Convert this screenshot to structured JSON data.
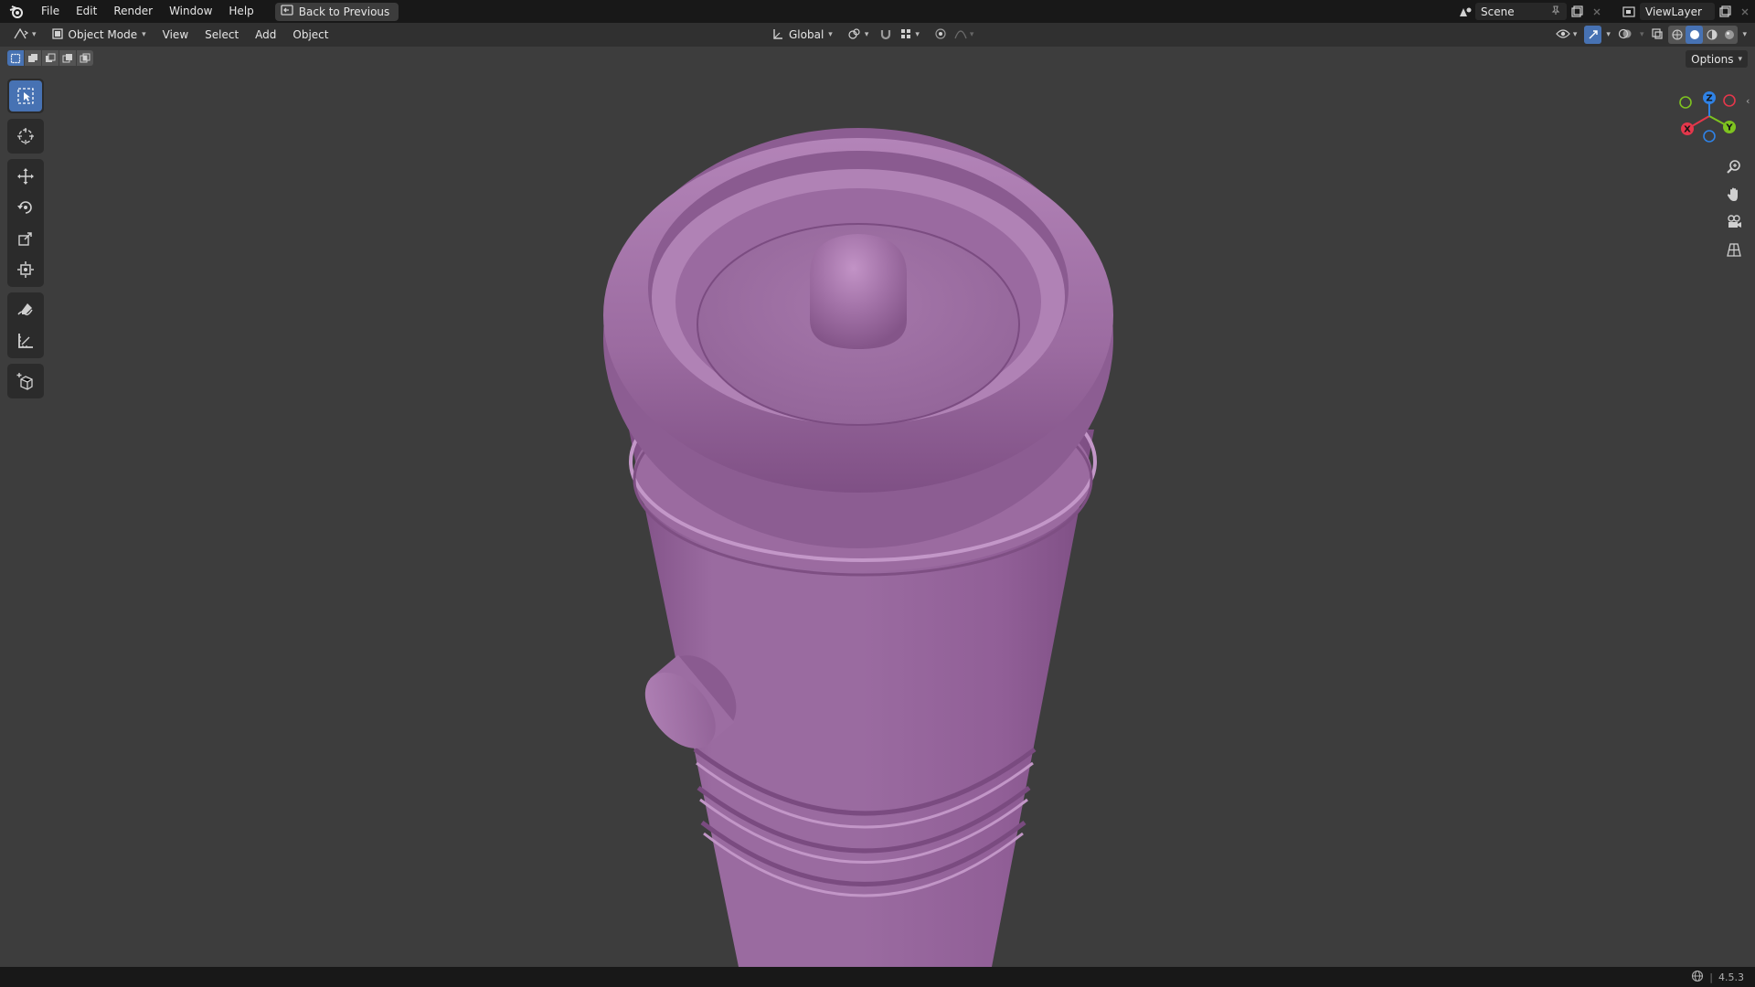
{
  "menu": {
    "items": [
      "File",
      "Edit",
      "Render",
      "Window",
      "Help"
    ],
    "back_button": "Back to Previous"
  },
  "workspace": {
    "scene_name": "Scene",
    "view_layer_name": "ViewLayer"
  },
  "viewport_header": {
    "mode": "Object Mode",
    "menus": [
      "View",
      "Select",
      "Add",
      "Object"
    ],
    "transform_orientation": "Global",
    "options_label": "Options"
  },
  "toolbar": {
    "tools": [
      "select-box",
      "cursor",
      "move",
      "rotate",
      "scale",
      "transform",
      "annotate",
      "measure",
      "add-cube"
    ],
    "active_tool": "select-box"
  },
  "gizmo": {
    "axes": [
      "X",
      "Y",
      "Z"
    ],
    "colors": {
      "x": "#e4374b",
      "y": "#7ec320",
      "z": "#2f82e6"
    }
  },
  "model": {
    "color": "#a373a8"
  },
  "status_bar": {
    "version": "4.5.3"
  }
}
